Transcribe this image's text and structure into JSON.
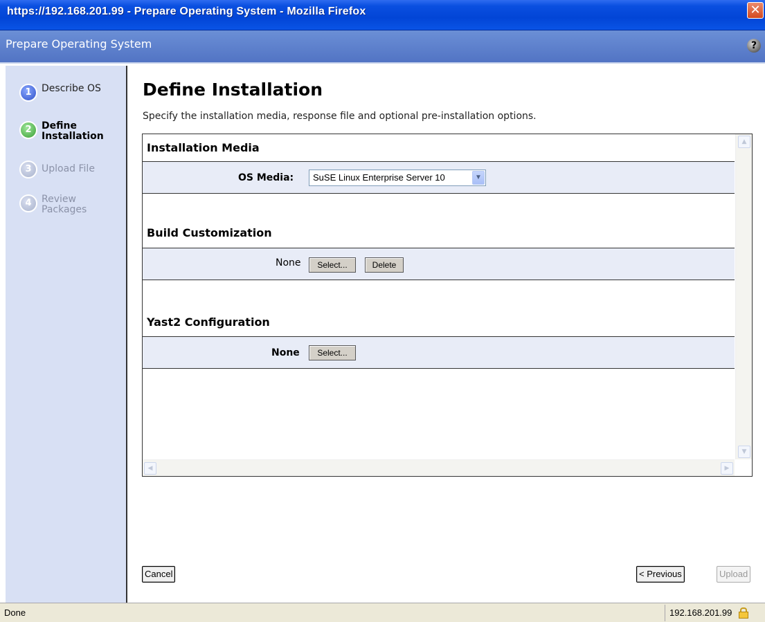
{
  "window": {
    "title": "https://192.168.201.99 - Prepare Operating System - Mozilla Firefox",
    "close_glyph": "✕"
  },
  "app": {
    "title": "Prepare Operating System",
    "help_glyph": "?"
  },
  "steps": [
    {
      "num": "1",
      "label": "Describe OS",
      "state": "done"
    },
    {
      "num": "2",
      "label": "Define Installation",
      "state": "current"
    },
    {
      "num": "3",
      "label": "Upload File",
      "state": "future"
    },
    {
      "num": "4",
      "label": "Review Packages",
      "state": "future"
    }
  ],
  "main": {
    "title": "Define Installation",
    "description": "Specify the installation media, response file and optional pre-installation options."
  },
  "installation_media": {
    "heading": "Installation Media",
    "os_media_label": "OS Media:",
    "os_media_value": "SuSE Linux Enterprise Server 10"
  },
  "build_customization": {
    "heading": "Build Customization",
    "value": "None",
    "select_label": "Select...",
    "delete_label": "Delete"
  },
  "yast2": {
    "heading": "Yast2 Configuration",
    "value": "None",
    "select_label": "Select..."
  },
  "footer": {
    "cancel_label": "Cancel",
    "previous_label": "< Previous",
    "upload_label": "Upload"
  },
  "statusbar": {
    "status": "Done",
    "host": "192.168.201.99"
  }
}
